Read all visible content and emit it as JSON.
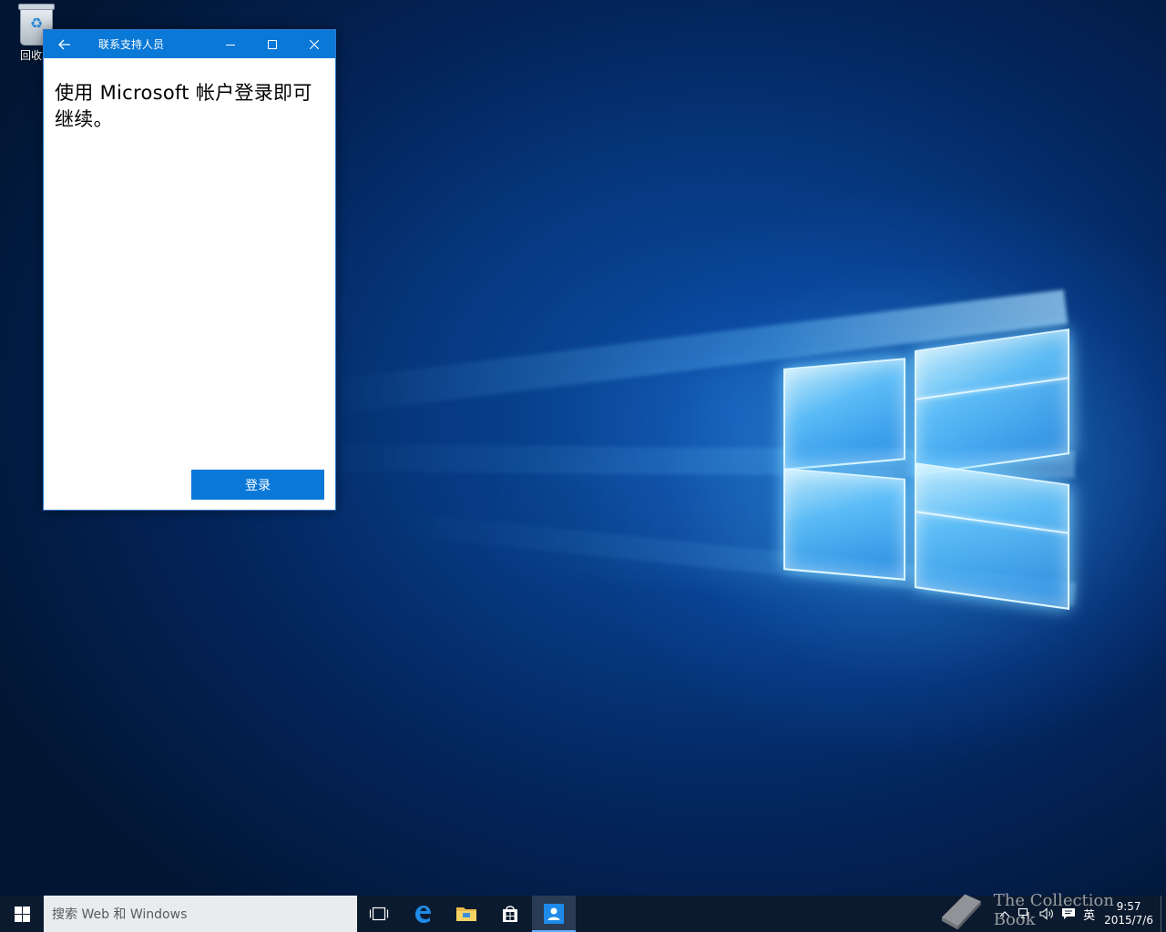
{
  "desktop": {
    "recycle_bin_label": "回收站"
  },
  "window": {
    "title": "联系支持人员",
    "heading": "使用 Microsoft 帐户登录即可继续。",
    "signin_label": "登录",
    "controls": [
      "back-icon",
      "minimize-icon",
      "maximize-icon",
      "close-icon"
    ]
  },
  "taskbar": {
    "search_placeholder": "搜索 Web 和 Windows",
    "pinned": [
      {
        "name": "task-view",
        "icon": "task-view-icon"
      },
      {
        "name": "edge",
        "icon": "edge-icon"
      },
      {
        "name": "file-explorer",
        "icon": "folder-icon"
      },
      {
        "name": "store",
        "icon": "store-icon"
      },
      {
        "name": "contact-support",
        "icon": "contact-support-icon",
        "active": true
      }
    ],
    "tray": {
      "input_language": "英",
      "time": "9:57",
      "date": "2015/7/6"
    }
  },
  "watermark": {
    "text": "The Collection Book"
  },
  "colors": {
    "accent": "#0a78d7",
    "taskbar": "#0b1a2e",
    "search_bg": "#e9ecef"
  }
}
